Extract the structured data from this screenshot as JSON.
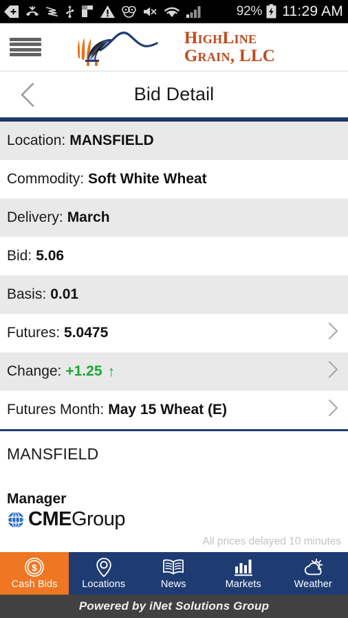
{
  "statusbar": {
    "icons": [
      "back-arrow-plus-icon",
      "call-missed-icon",
      "sprint-icon",
      "usb-icon",
      "flag-icon",
      "warning-triangle-icon",
      "headphones-mask-icon",
      "mute-icon",
      "wifi-icon",
      "signal-bars-icon"
    ],
    "battery_percent": "92%",
    "battery_icon": "battery-charging-icon",
    "clock": "11:29 AM"
  },
  "header": {
    "menu_icon": "hamburger-menu-icon",
    "logo_alt": "HighLine Grain, LLC",
    "logo_line1": "HighLine",
    "logo_line2": "Grain, LLC",
    "logo_orange": "#e8731c",
    "logo_navy": "#1e3c72"
  },
  "titlebar": {
    "back_icon": "chevron-left-icon",
    "title": "Bid Detail"
  },
  "detail_rows": [
    {
      "label": "Location:",
      "value": "MANSFIELD",
      "chevron": false,
      "shaded": true,
      "accent": false
    },
    {
      "label": "Commodity:",
      "value": "Soft White Wheat",
      "chevron": false,
      "shaded": false,
      "accent": false
    },
    {
      "label": "Delivery:",
      "value": "March",
      "chevron": false,
      "shaded": true,
      "accent": false
    },
    {
      "label": "Bid:",
      "value": "5.06",
      "chevron": false,
      "shaded": false,
      "accent": false
    },
    {
      "label": "Basis:",
      "value": "0.01",
      "chevron": false,
      "shaded": true,
      "accent": false
    },
    {
      "label": "Futures:",
      "value": "5.0475",
      "chevron": true,
      "shaded": false,
      "accent": false
    },
    {
      "label": "Change:",
      "value": "+1.25",
      "chevron": true,
      "shaded": true,
      "accent": true,
      "arrow": "↑"
    },
    {
      "label": "Futures Month:",
      "value": "May 15 Wheat (E)",
      "chevron": true,
      "shaded": false,
      "accent": false
    }
  ],
  "info": {
    "location_name": "MANSFIELD",
    "manager_label": "Manager",
    "cme_brand_bold": "CME",
    "cme_brand_light": "Group",
    "cme_globe_icon": "globe-icon",
    "delay_note": "All prices delayed 10 minutes"
  },
  "tabs": [
    {
      "label": "Cash Bids",
      "icon": "dollar-coin-icon",
      "active": true
    },
    {
      "label": "Locations",
      "icon": "map-pin-icon",
      "active": false
    },
    {
      "label": "News",
      "icon": "open-book-icon",
      "active": false
    },
    {
      "label": "Markets",
      "icon": "bar-chart-icon",
      "active": false
    },
    {
      "label": "Weather",
      "icon": "sun-cloud-icon",
      "active": false
    }
  ],
  "footer": {
    "text": "Powered by iNet Solutions Group"
  },
  "colors": {
    "navy": "#1e3c72",
    "orange": "#ef7622",
    "green": "#19a832",
    "row_shade": "#e9e9e9",
    "footer_gray": "#414141"
  }
}
